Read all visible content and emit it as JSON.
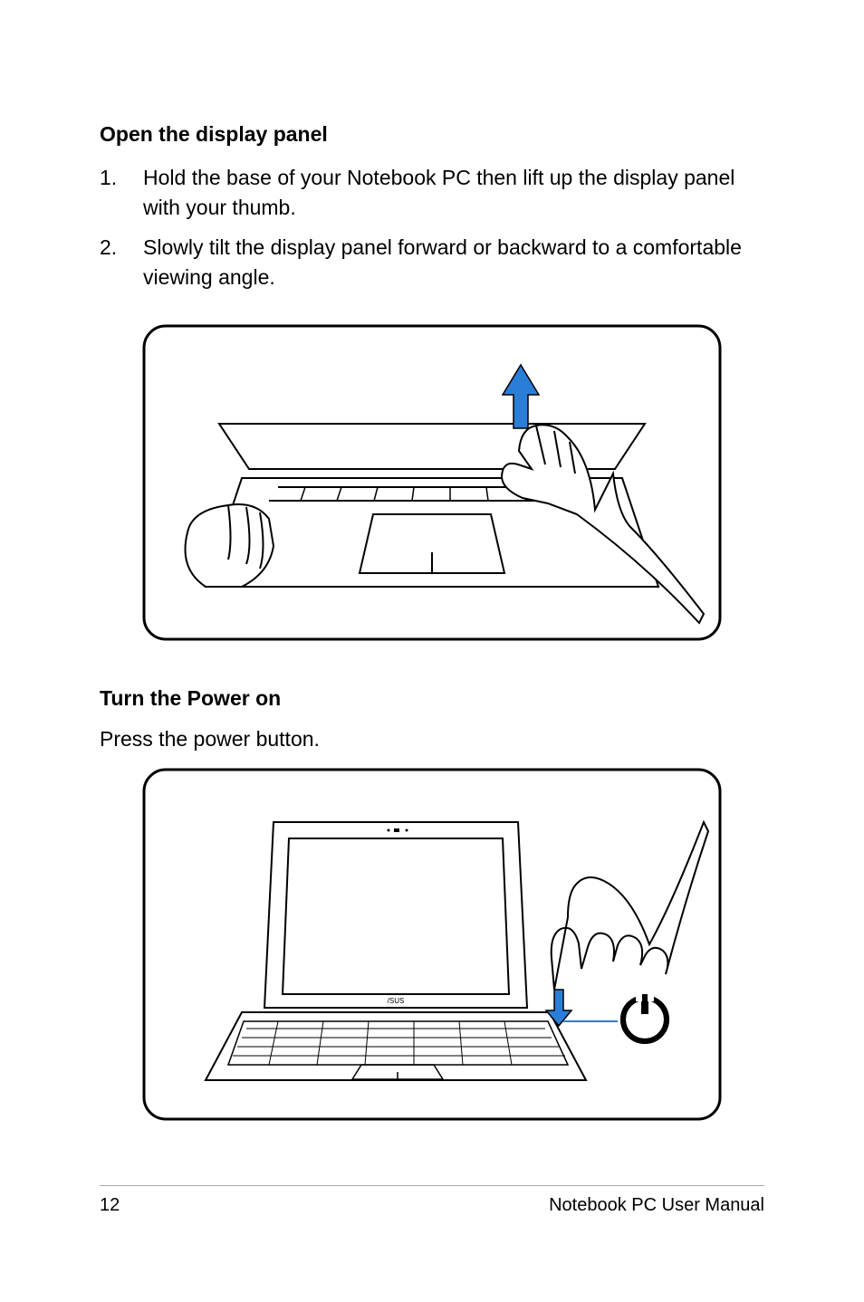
{
  "section1": {
    "heading": "Open the display panel",
    "steps": [
      {
        "num": "1.",
        "text": "Hold the base of your Notebook PC then lift up the display panel with your thumb."
      },
      {
        "num": "2.",
        "text": "Slowly tilt the display panel forward or backward to a comfortable viewing angle."
      }
    ]
  },
  "section2": {
    "heading": "Turn the Power on",
    "text": "Press the power button."
  },
  "footer": {
    "pageNumber": "12",
    "docTitle": "Notebook PC User Manual"
  }
}
